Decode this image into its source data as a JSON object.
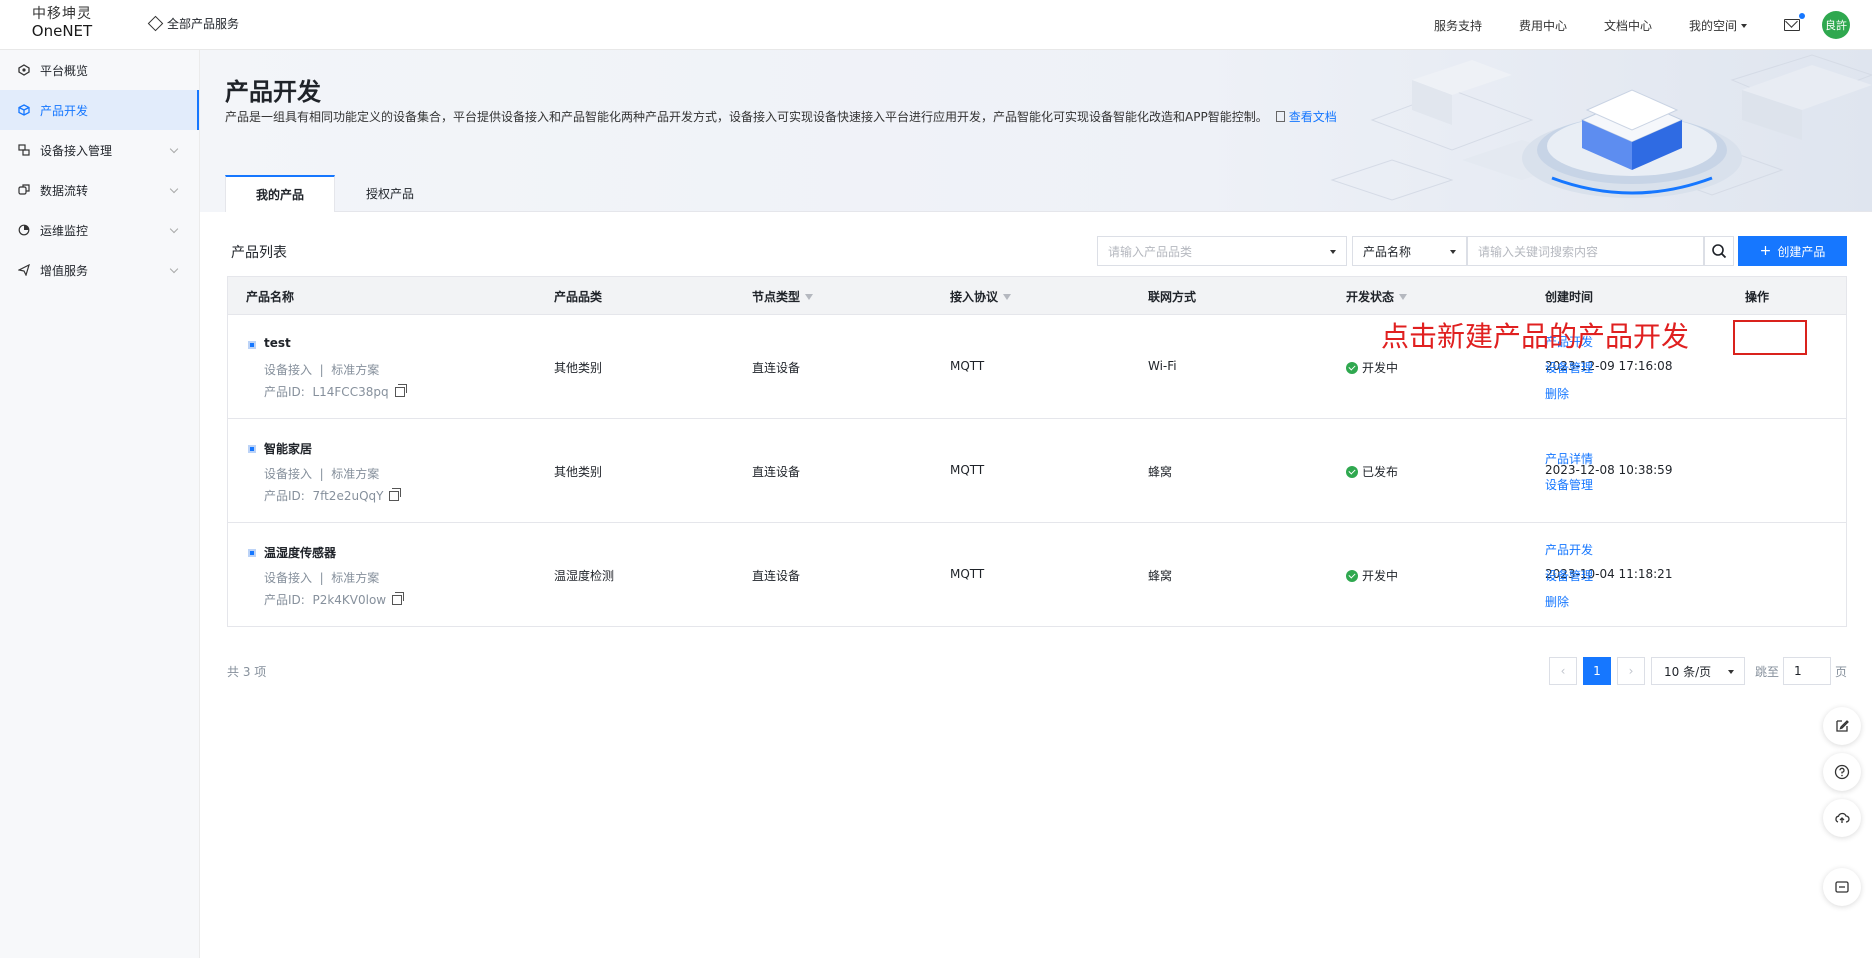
{
  "header": {
    "logo_cn": "中移坤灵",
    "logo_en": "OneNET",
    "all_products": "全部产品服务",
    "nav": [
      "服务支持",
      "费用中心",
      "文档中心",
      "我的空间"
    ],
    "avatar_text": "良許"
  },
  "sidebar": {
    "items": [
      {
        "label": "平台概览",
        "icon": "dashboard-icon"
      },
      {
        "label": "产品开发",
        "icon": "cube-icon"
      },
      {
        "label": "设备接入管理",
        "icon": "device-icon"
      },
      {
        "label": "数据流转",
        "icon": "flow-icon"
      },
      {
        "label": "运维监控",
        "icon": "monitor-icon"
      },
      {
        "label": "增值服务",
        "icon": "send-icon"
      }
    ]
  },
  "page": {
    "title": "产品开发",
    "description": "产品是一组具有相同功能定义的设备集合，平台提供设备接入和产品智能化两种产品开发方式，设备接入可实现设备快速接入平台进行应用开发，产品智能化可实现设备智能化改造和APP智能控制。",
    "doc_link": "查看文档",
    "tabs": [
      "我的产品",
      "授权产品"
    ]
  },
  "toolbar": {
    "list_title": "产品列表",
    "category_placeholder": "请输入产品品类",
    "field_select": "产品名称",
    "search_placeholder": "请输入关键词搜索内容",
    "create_label": "创建产品",
    "create_icon": "plus-icon"
  },
  "table": {
    "columns": [
      "产品名称",
      "产品品类",
      "节点类型",
      "接入协议",
      "联网方式",
      "开发状态",
      "创建时间",
      "操作"
    ],
    "rows": [
      {
        "name": "test",
        "meta": "设备接入  |  标准方案",
        "product_id": "产品ID:  L14FCC38pq",
        "category": "其他类别",
        "node_type": "直连设备",
        "protocol": "MQTT",
        "network": "Wi-Fi",
        "status": "开发中",
        "created": "2023-12-09 17:16:08",
        "actions": [
          "产品开发",
          "设备管理",
          "删除"
        ]
      },
      {
        "name": "智能家居",
        "meta": "设备接入  |  标准方案",
        "product_id": "产品ID:  7ft2e2uQqY",
        "category": "其他类别",
        "node_type": "直连设备",
        "protocol": "MQTT",
        "network": "蜂窝",
        "status": "已发布",
        "created": "2023-12-08 10:38:59",
        "actions": [
          "产品详情",
          "设备管理"
        ]
      },
      {
        "name": "温湿度传感器",
        "meta": "设备接入  |  标准方案",
        "product_id": "产品ID:  P2k4KV0low",
        "category": "温湿度检测",
        "node_type": "直连设备",
        "protocol": "MQTT",
        "network": "蜂窝",
        "status": "开发中",
        "created": "2023-10-04 11:18:21",
        "actions": [
          "产品开发",
          "设备管理",
          "删除"
        ]
      }
    ]
  },
  "annotation": "点击新建产品的产品开发",
  "pagination": {
    "total": "共 3 项",
    "prev": "‹",
    "current": "1",
    "next": "›",
    "page_size": "10 条/页",
    "jump_label": "跳至",
    "jump_value": "1",
    "page_unit": "页"
  },
  "colors": {
    "accent": "#1677ff",
    "success": "#2fa84f",
    "annotation": "#e02020"
  }
}
